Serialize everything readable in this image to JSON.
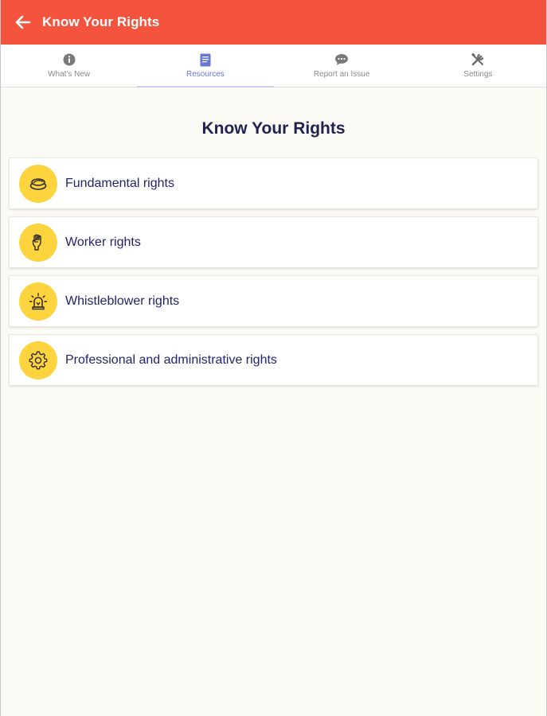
{
  "app_bar": {
    "title": "Know Your Rights",
    "background": "#f4533e",
    "back_icon": "arrow-left-icon"
  },
  "tabs": [
    {
      "label": "What's New",
      "icon": "info-circle-icon",
      "active": false
    },
    {
      "label": "Resources",
      "icon": "document-icon",
      "active": true
    },
    {
      "label": "Report an Issue",
      "icon": "chat-bubble-icon",
      "active": false
    },
    {
      "label": "Settings",
      "icon": "tools-icon",
      "active": false
    }
  ],
  "main": {
    "title": "Know Your Rights",
    "items": [
      {
        "label": "Fundamental rights",
        "icon": "stack-icon"
      },
      {
        "label": "Worker rights",
        "icon": "raised-fist-icon"
      },
      {
        "label": "Whistleblower rights",
        "icon": "alarm-siren-icon"
      },
      {
        "label": "Professional and administrative rights",
        "icon": "gear-icon"
      }
    ]
  },
  "colors": {
    "accent": "#f4533e",
    "active_tab": "#6676d6",
    "badge": "#fdd33e",
    "text_primary": "#22246a"
  }
}
